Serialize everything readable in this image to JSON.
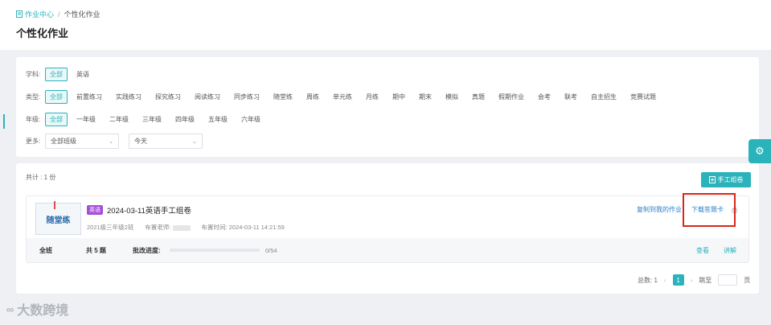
{
  "breadcrumb": {
    "home": "作业中心",
    "current": "个性化作业"
  },
  "page_title": "个性化作业",
  "filters": {
    "subject": {
      "label": "学科:",
      "options": [
        "全部",
        "英语"
      ],
      "active": 0
    },
    "type": {
      "label": "类型:",
      "options": [
        "全部",
        "前置练习",
        "实践练习",
        "探究练习",
        "阅读练习",
        "同步练习",
        "随堂练",
        "周练",
        "单元练",
        "月练",
        "期中",
        "期末",
        "模拟",
        "真题",
        "假期作业",
        "会考",
        "联考",
        "自主招生",
        "竞赛试题"
      ],
      "active": 0
    },
    "grade": {
      "label": "年级:",
      "options": [
        "全部",
        "一年级",
        "二年级",
        "三年级",
        "四年级",
        "五年级",
        "六年级"
      ],
      "active": 0
    },
    "more": {
      "label": "更多:",
      "class_select": "全部班级",
      "date_select": "今天"
    }
  },
  "list": {
    "total": "共计 : 1 份",
    "make_button": "手工组卷",
    "item": {
      "cover_text": "随堂练",
      "subject_badge": "英语",
      "title": "2024-03-11英语手工组卷",
      "class_name": "2021级三年级2班",
      "teacher_label": "布置老师:",
      "time_label": "布置时间:",
      "time": "2024-03-11 14:21:59",
      "copy_action": "复制到我的作业",
      "download_action": "下载答题卡",
      "footer": {
        "scope": "全班",
        "question_count": "共 5 题",
        "progress_label": "批改进度:",
        "progress_fraction": 0,
        "progress_text": "0/54",
        "view": "查看",
        "explain": "讲解"
      }
    }
  },
  "pagination": {
    "total": "总数: 1",
    "current_page": "1",
    "jump_label": "跳至",
    "page_unit": "页"
  },
  "watermark": "大数跨境",
  "colors": {
    "accent": "#2bb3bb",
    "link": "#2b7fc4",
    "badge": "#a44ed9",
    "highlight": "#d9261c"
  },
  "icons": {
    "breadcrumb": "document-icon",
    "make_button": "document-add-icon",
    "print": "print-icon",
    "settings": "gear-icon"
  }
}
